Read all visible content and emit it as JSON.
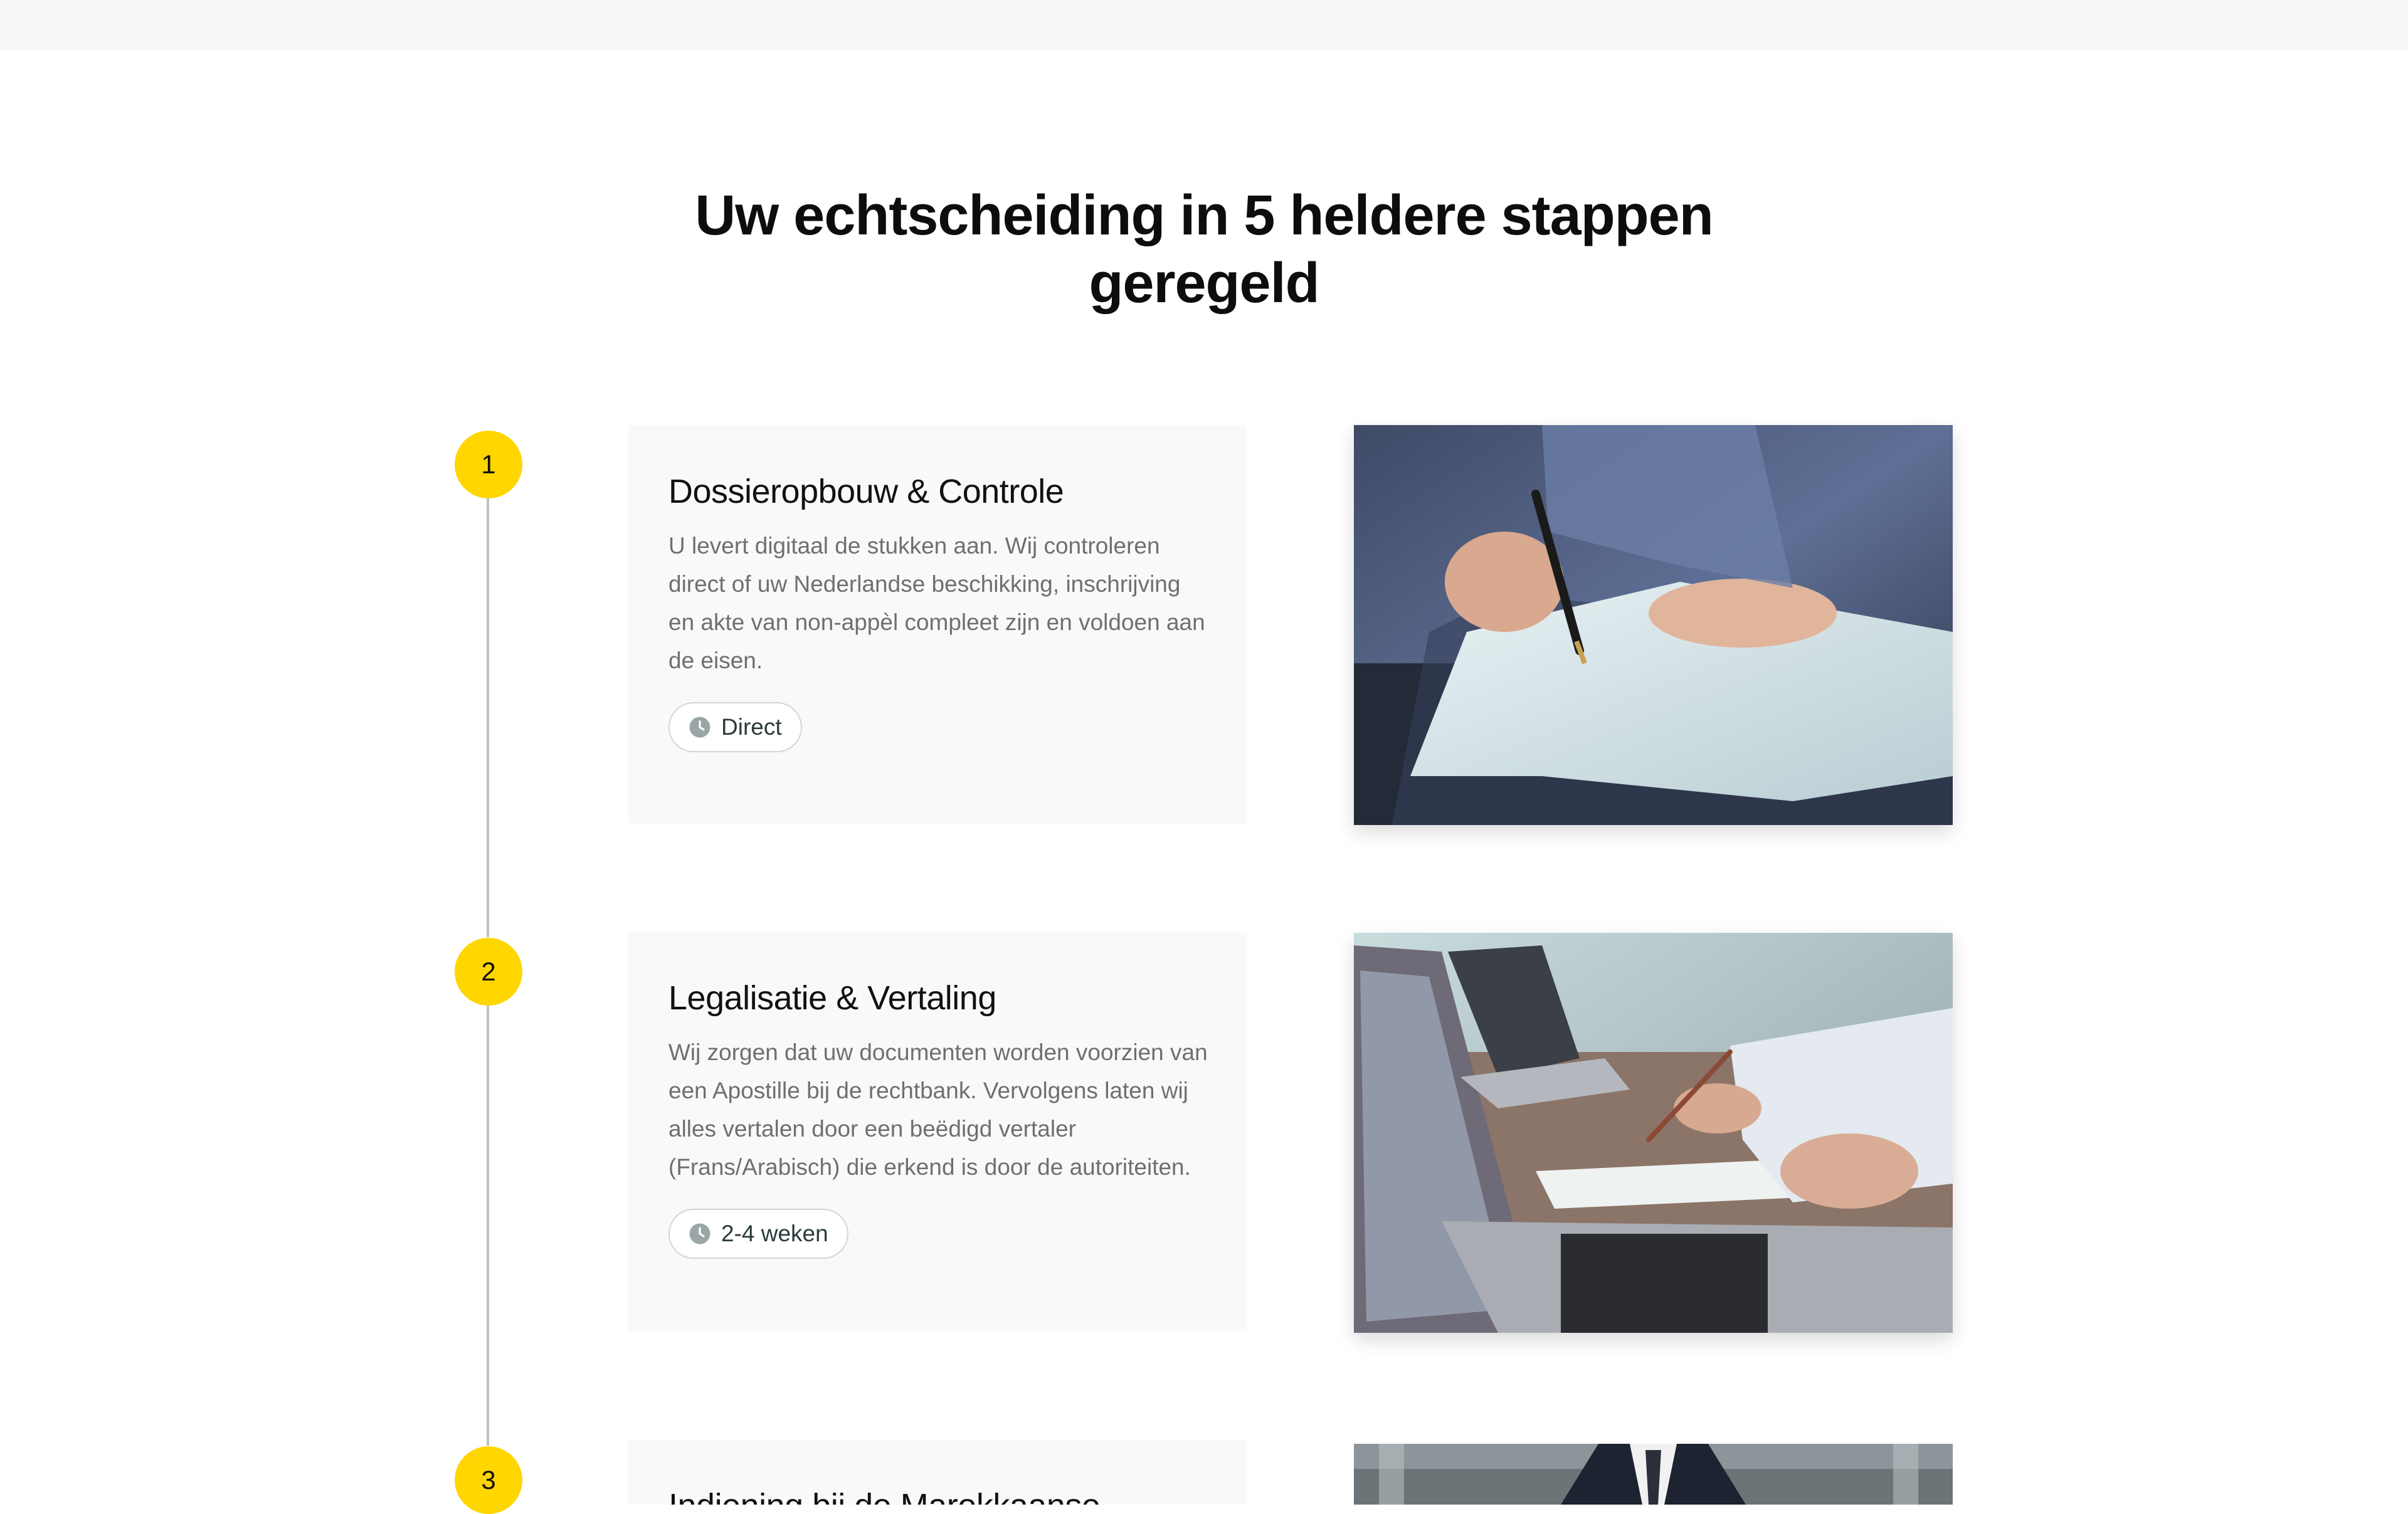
{
  "section": {
    "title": "Uw echtscheiding in 5 heldere stappen geregeld"
  },
  "steps": [
    {
      "number": "1",
      "title": "Dossieropbouw & Controle",
      "description": "U levert digitaal de stukken aan. Wij controleren direct of uw Nederlandse beschikking, inschrijving en akte van non-appèl compleet zijn en voldoen aan de eisen.",
      "duration": "Direct",
      "duration_icon": "clock-icon",
      "image_subject": "hand-signing-document-photo"
    },
    {
      "number": "2",
      "title": "Legalisatie & Vertaling",
      "description": "Wij zorgen dat uw documenten worden voorzien van een Apostille bij de rechtbank. Vervolgens laten wij alles vertalen door een beëdigd vertaler (Frans/Arabisch) die erkend is door de autoriteiten.",
      "duration": "2-4 weken",
      "duration_icon": "clock-icon",
      "image_subject": "laptops-and-paperwork-photo"
    },
    {
      "number": "3",
      "title": "Indiening bij de Marokkaanse",
      "image_subject": "businessman-in-suit-photo"
    }
  ],
  "colors": {
    "accent": "#ffd600",
    "timeline": "#b9c2c2",
    "card_background": "#f9f9f9",
    "body_text": "#6f6f6f",
    "heading_text": "#111111"
  }
}
